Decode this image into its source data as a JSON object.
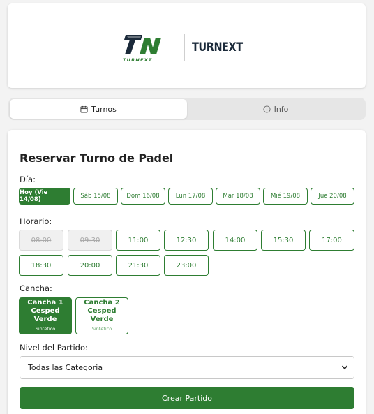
{
  "brand": {
    "logo_subtext": "TURNEXT",
    "wordmark": "TURNEXT",
    "accent": "#2e7d32",
    "dark": "#1b2a3a"
  },
  "tabs": [
    {
      "label": "Turnos",
      "icon": "calendar-icon",
      "active": true
    },
    {
      "label": "Info",
      "icon": "info-icon",
      "active": false
    }
  ],
  "form": {
    "title": "Reservar Turno de Padel",
    "day_label": "Día:",
    "days": [
      "Hoy (Vie 14/08)",
      "Sáb 15/08",
      "Dom 16/08",
      "Lun 17/08",
      "Mar 18/08",
      "Mié 19/08",
      "Jue 20/08"
    ],
    "selected_day": "Hoy (Vie 14/08)",
    "time_label": "Horario:",
    "times": [
      "08:00",
      "09:30",
      "11:00",
      "12:30",
      "14:00",
      "15:30",
      "17:00",
      "18:30",
      "20:00",
      "21:30",
      "23:00"
    ],
    "disabled_times": [
      "08:00",
      "09:30"
    ],
    "court_label": "Cancha:",
    "courts": [
      {
        "line1": "Cancha 1",
        "line2": "Cesped Verde",
        "type": "Sintético",
        "selected": true
      },
      {
        "line1": "Cancha 2",
        "line2": "Cesped Verde",
        "type": "Sintético",
        "selected": false
      }
    ],
    "level_label": "Nivel del Partido:",
    "level_value": "Todas las Categoria",
    "submit_label": "Crear Partido"
  }
}
